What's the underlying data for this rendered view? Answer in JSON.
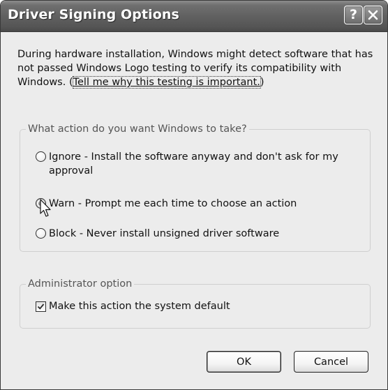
{
  "window": {
    "title": "Driver Signing Options",
    "help_glyph": "?",
    "close_icon": "close-icon"
  },
  "description": {
    "line_text": "During hardware installation, Windows might detect software that has not passed Windows Logo testing to verify its compatibility with Windows. (",
    "link_text": "Tell me why this testing is important.",
    "close_paren": ")"
  },
  "action_group": {
    "label": "What action do you want Windows to take?",
    "options": [
      {
        "label": "Ignore - Install the software anyway and don't ask for my approval",
        "checked": false
      },
      {
        "label": "Warn - Prompt me each time to choose an action",
        "checked": true
      },
      {
        "label": "Block - Never install unsigned driver software",
        "checked": false
      }
    ]
  },
  "admin_group": {
    "label": "Administrator option",
    "checkbox_label": "Make this action the system default",
    "checked": true
  },
  "buttons": {
    "ok": "OK",
    "cancel": "Cancel"
  },
  "colors": {
    "titlebar": "#5f5f5f",
    "dialog_bg": "#ececec"
  }
}
